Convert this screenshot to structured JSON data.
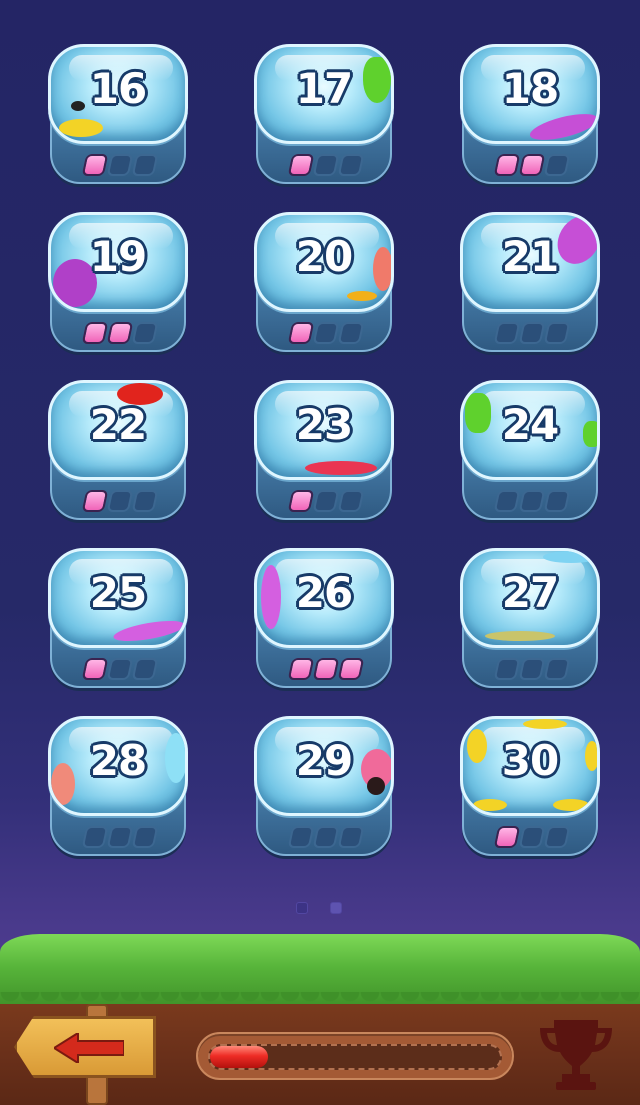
{
  "levels": [
    {
      "number": "16",
      "stars": 1
    },
    {
      "number": "17",
      "stars": 1
    },
    {
      "number": "18",
      "stars": 2
    },
    {
      "number": "19",
      "stars": 2
    },
    {
      "number": "20",
      "stars": 1
    },
    {
      "number": "21",
      "stars": 0
    },
    {
      "number": "22",
      "stars": 1
    },
    {
      "number": "23",
      "stars": 1
    },
    {
      "number": "24",
      "stars": 0
    },
    {
      "number": "25",
      "stars": 1
    },
    {
      "number": "26",
      "stars": 3
    },
    {
      "number": "27",
      "stars": 0
    },
    {
      "number": "28",
      "stars": 0
    },
    {
      "number": "29",
      "stars": 0
    },
    {
      "number": "30",
      "stars": 1
    }
  ],
  "pager": {
    "count": 2,
    "active": 1
  },
  "progress": {
    "fraction": 0.2
  },
  "icons": {
    "back": "back-arrow-icon",
    "trophy": "trophy-icon"
  },
  "colors": {
    "gem_on": "#f064b8",
    "gem_off": "#2b4f79",
    "progress_fill": "#ee2c25",
    "trophy": "#5a1410"
  }
}
